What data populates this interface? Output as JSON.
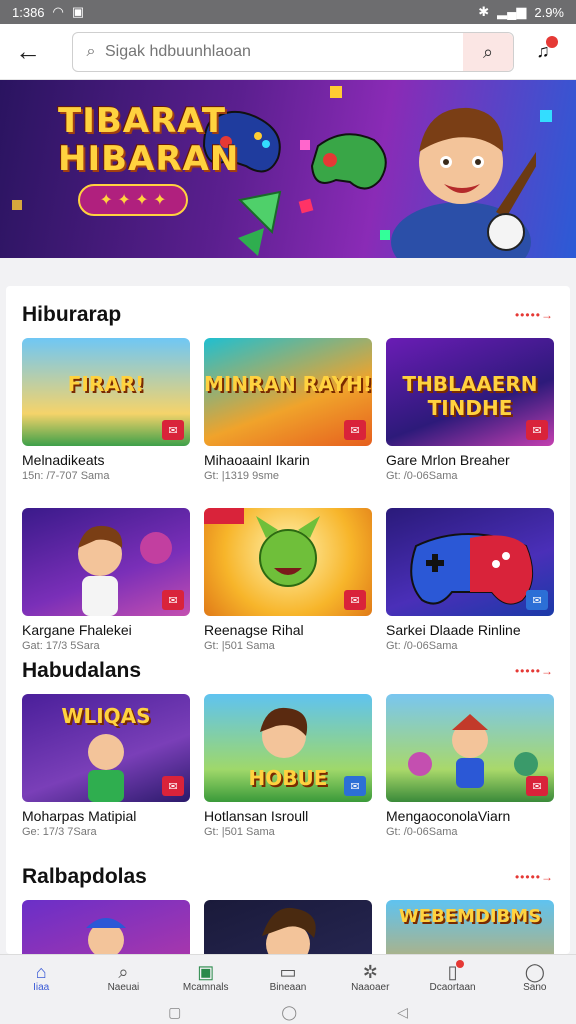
{
  "status_bar": {
    "time": "1:386",
    "battery": "2.9%"
  },
  "search": {
    "placeholder": "Sigak hdbuunhlaoan"
  },
  "banner": {
    "title_line1": "TIBARAT",
    "title_line2": "HIBARAN",
    "stars": "✦ ✦ ✦ ✦"
  },
  "sections": [
    {
      "title": "Hiburarap",
      "more": "•••••→",
      "cards": [
        {
          "label": "FIRAR!",
          "name": "Melnadikeats",
          "meta": "15n: /7-707 Sama",
          "badge": "red"
        },
        {
          "label": "MINRAN RAYH!",
          "name": "Mihaoaainl Ikarin",
          "meta": "Gt: |1319 9sme",
          "badge": "red"
        },
        {
          "label": "THBLAAERN TINDHE",
          "name": "Gare Mrlon Breaher",
          "meta": "Gt: /0-06Sama",
          "badge": "red"
        },
        {
          "label": "",
          "name": "Kargane Fhalekei",
          "meta": "Gat: 17/3 5Sara",
          "badge": "red"
        },
        {
          "label": "",
          "name": "Reenagse Rihal",
          "meta": "Gt: |501 Sama",
          "badge": "red"
        },
        {
          "label": "",
          "name": "Sarkei Dlaade Rinline",
          "meta": "Gt: /0-06Sama",
          "badge": "blue"
        }
      ]
    },
    {
      "title": "Habudalans",
      "more": "•••••→",
      "cards": [
        {
          "label": "WLIQAS",
          "name": "Moharpas Matipial",
          "meta": "Ge: 17/3 7Sara",
          "badge": "red"
        },
        {
          "label": "HOBUE",
          "name": "Hotlansan Isroull",
          "meta": "Gt: |501 Sama",
          "badge": "blue"
        },
        {
          "label": "",
          "name": "MengaoconolaViarn",
          "meta": "Gt: /0-06Sama",
          "badge": "red"
        }
      ]
    },
    {
      "title": "Ralbapdolas",
      "more": "•••••→",
      "cards": [
        {
          "label": "",
          "name": "",
          "meta": "",
          "badge": ""
        },
        {
          "label": "",
          "name": "",
          "meta": "",
          "badge": ""
        },
        {
          "label": "WEBEMDIBMS",
          "name": "",
          "meta": "",
          "badge": ""
        }
      ]
    }
  ],
  "bottom_nav": [
    {
      "label": "Iiaa",
      "icon": "home-icon",
      "glyph": "⌂",
      "active": true
    },
    {
      "label": "Naeuai",
      "icon": "search-icon",
      "glyph": "⌕",
      "active": false
    },
    {
      "label": "Mcamnals",
      "icon": "store-icon",
      "glyph": "▣",
      "active": false
    },
    {
      "label": "Bineaan",
      "icon": "tv-icon",
      "glyph": "▭",
      "active": false
    },
    {
      "label": "Naaoaer",
      "icon": "gear-icon",
      "glyph": "✲",
      "active": false
    },
    {
      "label": "Dcaortaan",
      "icon": "library-icon",
      "glyph": "▯",
      "active": false
    },
    {
      "label": "Sano",
      "icon": "profile-icon",
      "glyph": "◯",
      "active": false
    }
  ],
  "colors": {
    "accent": "#e53935",
    "nav_active": "#3b5bd6",
    "banner_title": "#ffd23f"
  }
}
